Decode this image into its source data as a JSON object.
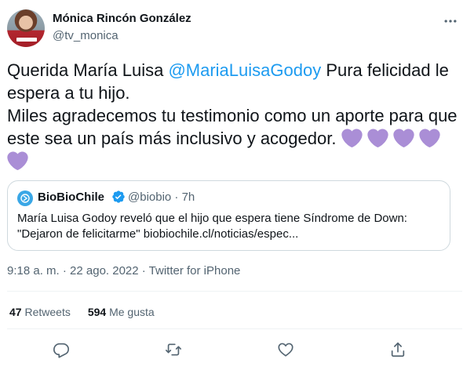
{
  "author": {
    "name": "Mónica Rincón González",
    "handle": "@tv_monica"
  },
  "tweet": {
    "line1_prefix": "Querida María Luisa ",
    "mention": "@MariaLuisaGodoy",
    "line1_suffix": " Pura felicidad le espera a tu hijo.",
    "line2": "Miles agradecemos tu testimonio como un aporte para que este sea un país más inclusivo y acogedor. ",
    "emoji": "purple-heart",
    "emoji_count": 5
  },
  "quote": {
    "name": "BioBioChile",
    "handle": "@biobio · 7h",
    "line1": "María Luisa Godoy reveló que el hijo que espera tiene Síndrome de Down:",
    "line2": "\"Dejaron de felicitarme\"  biobiochile.cl/noticias/espec..."
  },
  "meta": {
    "time": "9:18 a. m. · 22 ago. 2022 · Twitter for iPhone"
  },
  "stats": {
    "retweets_count": "47",
    "retweets_label": "Retweets",
    "likes_count": "594",
    "likes_label": "Me gusta"
  },
  "icons": {
    "more": "more-icon",
    "verified": "verified-icon",
    "reply": "reply-icon",
    "retweet": "retweet-icon",
    "like": "like-icon",
    "share": "share-icon"
  },
  "colors": {
    "accent": "#1d9bf0",
    "text": "#0f1419",
    "secondary": "#536471",
    "border": "#cfd9de",
    "heart": "#aa8ed6"
  }
}
